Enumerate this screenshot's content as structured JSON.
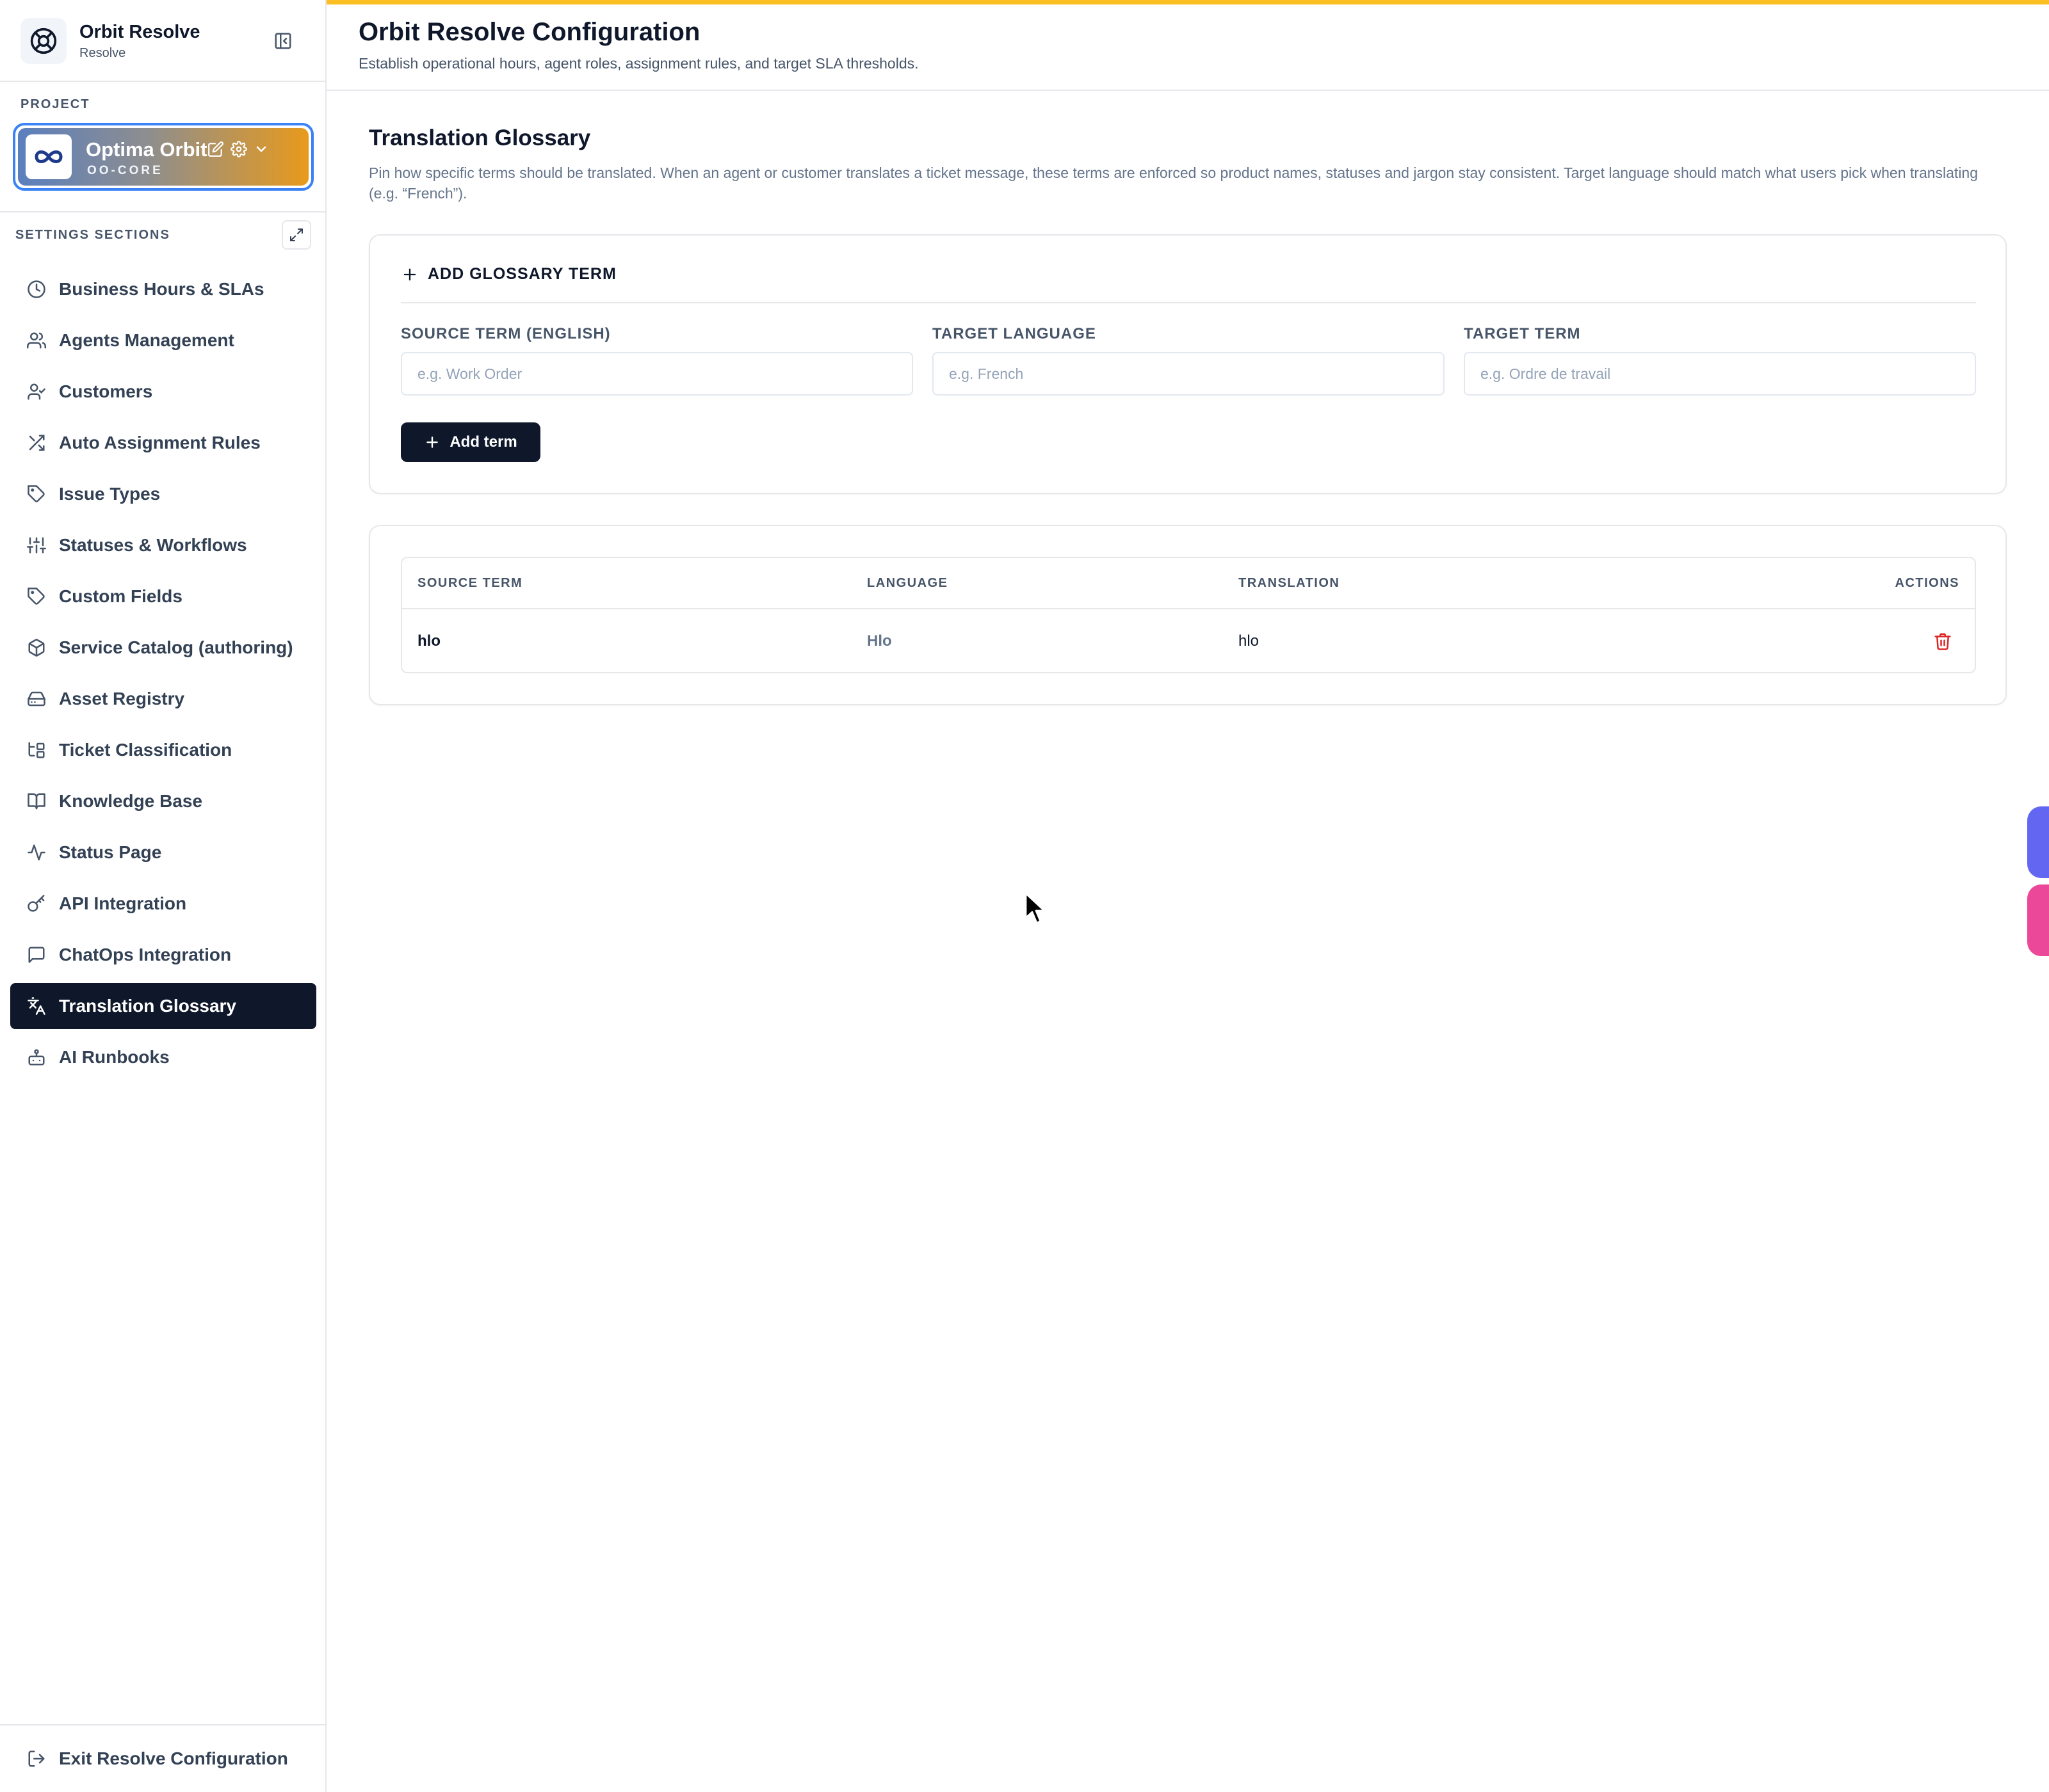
{
  "app": {
    "name": "Orbit Resolve",
    "subtitle": "Resolve",
    "accent_color": "#fbbf24"
  },
  "sidebar": {
    "project_label": "PROJECT",
    "project": {
      "name": "Optima Orbit",
      "code": "OO-CORE"
    },
    "sections_label": "SETTINGS SECTIONS",
    "items": [
      {
        "label": "Business Hours & SLAs",
        "icon": "clock-icon"
      },
      {
        "label": "Agents Management",
        "icon": "users-icon"
      },
      {
        "label": "Customers",
        "icon": "user-check-icon"
      },
      {
        "label": "Auto Assignment Rules",
        "icon": "shuffle-icon"
      },
      {
        "label": "Issue Types",
        "icon": "tag-icon"
      },
      {
        "label": "Statuses & Workflows",
        "icon": "sliders-icon"
      },
      {
        "label": "Custom Fields",
        "icon": "tag-icon"
      },
      {
        "label": "Service Catalog (authoring)",
        "icon": "package-icon"
      },
      {
        "label": "Asset Registry",
        "icon": "hard-drive-icon"
      },
      {
        "label": "Ticket Classification",
        "icon": "folder-tree-icon"
      },
      {
        "label": "Knowledge Base",
        "icon": "book-open-icon"
      },
      {
        "label": "Status Page",
        "icon": "activity-icon"
      },
      {
        "label": "API Integration",
        "icon": "key-icon"
      },
      {
        "label": "ChatOps Integration",
        "icon": "message-square-icon"
      },
      {
        "label": "Translation Glossary",
        "icon": "languages-icon",
        "active": true
      },
      {
        "label": "AI Runbooks",
        "icon": "bot-icon"
      }
    ],
    "exit_label": "Exit Resolve Configuration"
  },
  "header": {
    "title": "Orbit Resolve Configuration",
    "subtitle": "Establish operational hours, agent roles, assignment rules, and target SLA thresholds."
  },
  "glossary": {
    "title": "Translation Glossary",
    "description": "Pin how specific terms should be translated. When an agent or customer translates a ticket message, these terms are enforced so product names, statuses and jargon stay consistent. Target language should match what users pick when translating (e.g. “French”).",
    "add_heading": "ADD GLOSSARY TERM",
    "fields": {
      "source": {
        "label": "SOURCE TERM (ENGLISH)",
        "placeholder": "e.g. Work Order",
        "value": ""
      },
      "language": {
        "label": "TARGET LANGUAGE",
        "placeholder": "e.g. French",
        "value": ""
      },
      "target": {
        "label": "TARGET TERM",
        "placeholder": "e.g. Ordre de travail",
        "value": ""
      }
    },
    "add_button": "Add term",
    "table": {
      "columns": [
        "SOURCE TERM",
        "LANGUAGE",
        "TRANSLATION",
        "ACTIONS"
      ],
      "rows": [
        {
          "source": "hlo",
          "language": "Hlo",
          "translation": "hlo"
        }
      ]
    }
  },
  "colors": {
    "active_nav": "#0f172a",
    "delete": "#dc2626",
    "fab_primary": "#6366f1",
    "fab_secondary": "#ec4899"
  }
}
